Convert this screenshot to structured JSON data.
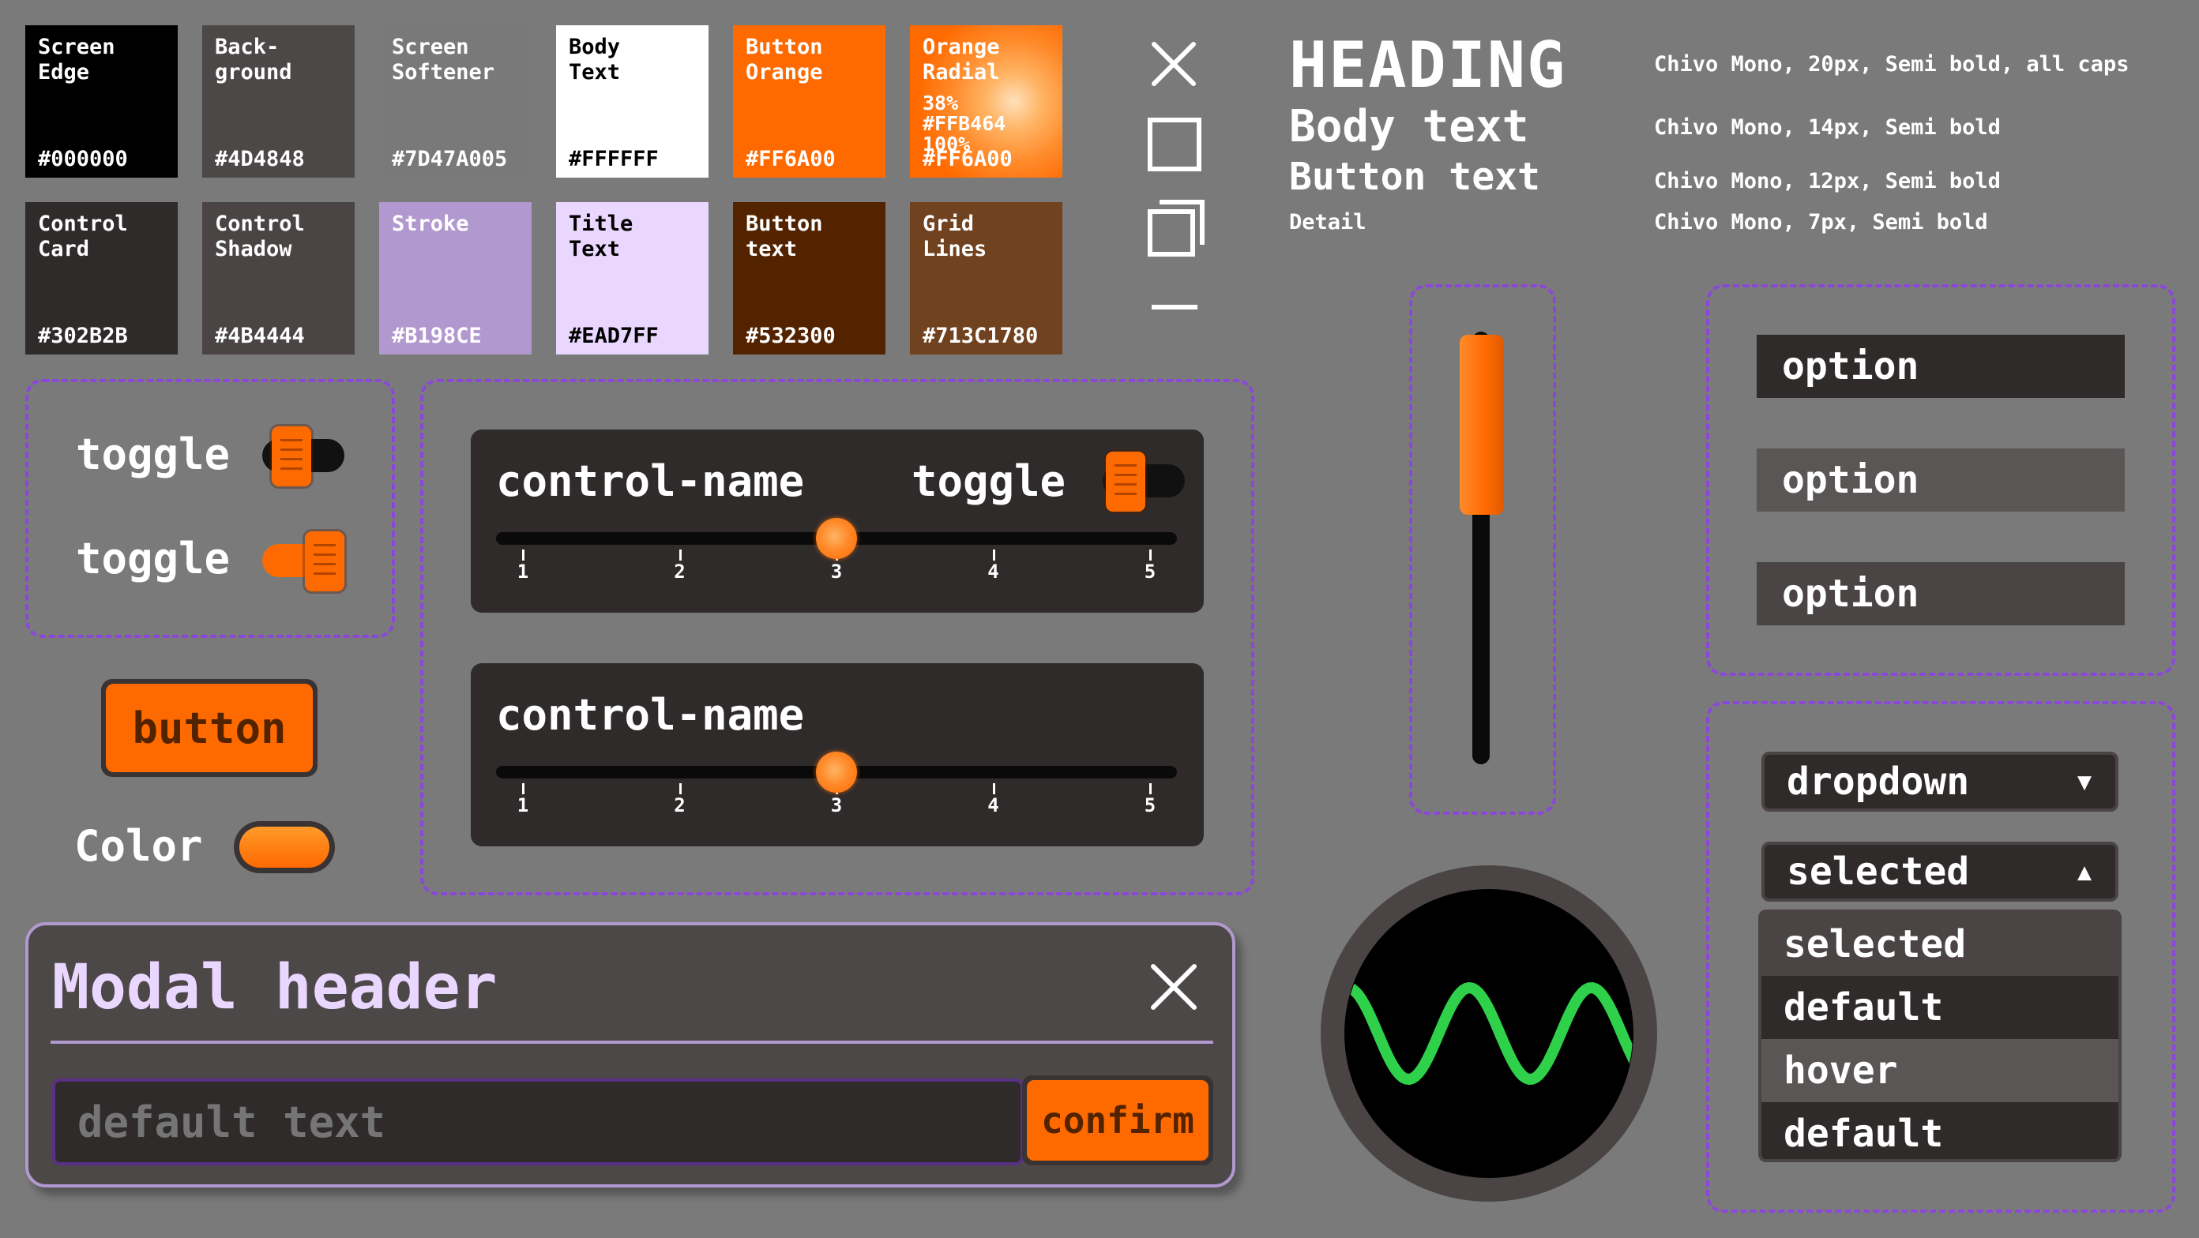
{
  "swatches": [
    {
      "name": "Screen\nEdge",
      "code": "#000000",
      "bg": "#000000",
      "fg": "#FFFFFF"
    },
    {
      "name": "Back-\nground",
      "code": "#4D4848",
      "bg": "#4D4848",
      "fg": "#FFFFFF"
    },
    {
      "name": "Screen\nSoftener",
      "code": "#7D47A005",
      "bg": "#797979",
      "fg": "#FFFFFF"
    },
    {
      "name": "Body\nText",
      "code": "#FFFFFF",
      "bg": "#FFFFFF",
      "fg": "#000000"
    },
    {
      "name": "Button\nOrange",
      "code": "#FF6A00",
      "bg": "#FF6A00",
      "fg": "#FFFFFF"
    },
    {
      "name": "Orange\nRadial",
      "code": "#FF6A00",
      "sub": "38%\n#FFB464\n100%",
      "bg": "radial",
      "fg": "#FFFFFF"
    },
    {
      "name": "Control\nCard",
      "code": "#302B2B",
      "bg": "#302B2B",
      "fg": "#FFFFFF"
    },
    {
      "name": "Control\nShadow",
      "code": "#4B4444",
      "bg": "#4B4444",
      "fg": "#FFFFFF"
    },
    {
      "name": "Stroke",
      "code": "#B198CE",
      "bg": "#B198CE",
      "fg": "#FFFFFF"
    },
    {
      "name": "Title\nText",
      "code": "#EAD7FF",
      "bg": "#EAD7FF",
      "fg": "#000000"
    },
    {
      "name": "Button\ntext",
      "code": "#532300",
      "bg": "#532300",
      "fg": "#FFFFFF"
    },
    {
      "name": "Grid\nLines",
      "code": "#713C1780",
      "bg": "#71421F",
      "fg": "#FFFFFF"
    }
  ],
  "typography": {
    "heading": "HEADING",
    "body": "Body text",
    "button": "Button text",
    "detail": "Detail",
    "heading_spec": "Chivo Mono, 20px, Semi bold, all caps",
    "body_spec": "Chivo Mono, 14px, Semi bold",
    "button_spec": "Chivo Mono, 12px, Semi bold",
    "detail_spec": "Chivo Mono, 7px, Semi bold"
  },
  "toggles": {
    "toggle1": {
      "label": "toggle",
      "on": false
    },
    "toggle2": {
      "label": "toggle",
      "on": true
    }
  },
  "button": {
    "label": "button"
  },
  "color": {
    "label": "Color",
    "value": "#FF6A00"
  },
  "controls": [
    {
      "title": "control-name",
      "toggle_label": "toggle",
      "toggle_on": false,
      "value": 3,
      "ticks": [
        "1",
        "2",
        "3",
        "4",
        "5"
      ]
    },
    {
      "title": "control-name",
      "value": 3,
      "ticks": [
        "1",
        "2",
        "3",
        "4",
        "5"
      ]
    }
  ],
  "vertical_slider": {
    "value": 0.42
  },
  "options": [
    "option",
    "option",
    "option"
  ],
  "dropdowns": {
    "closed": "dropdown",
    "open": "selected",
    "items": [
      "selected",
      "default",
      "hover",
      "default"
    ]
  },
  "modal": {
    "header": "Modal header",
    "placeholder": "default text",
    "confirm": "confirm"
  },
  "colors": {
    "orange": "#FF6A00",
    "card": "#302B2B",
    "stroke": "#8B48D8",
    "title_text": "#EAD7FF",
    "wave": "#2FD14A"
  }
}
